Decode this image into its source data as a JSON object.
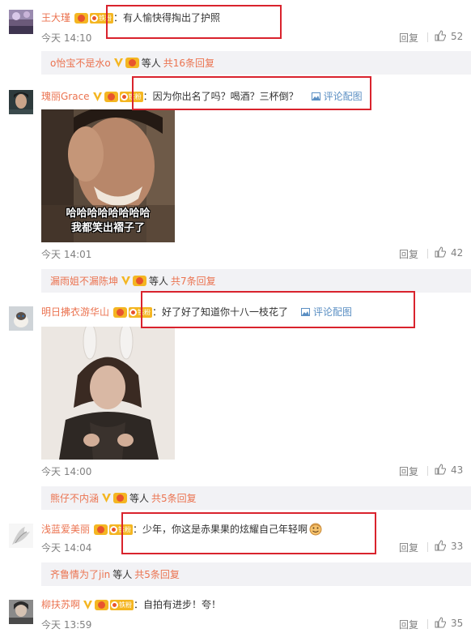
{
  "common": {
    "reply_label": "回复",
    "pic_label": "评论配图",
    "fan_badge_label": "铁粉",
    "others_label": "等人"
  },
  "comments": [
    {
      "user": "王大瑾",
      "text": "有人愉快得掏出了护照",
      "time": "今天 14:10",
      "likes": "52",
      "sub": {
        "who": "o怡宝不是水o",
        "total": "共16条回复"
      }
    },
    {
      "user": "瑰丽Grace",
      "text": "因为你出名了吗？喝酒？三杯倒？",
      "has_pic": true,
      "image_caption_line1": "哈哈哈哈哈哈哈哈",
      "image_caption_line2": "我都笑出褶子了",
      "time": "今天 14:01",
      "likes": "42",
      "sub": {
        "who": "漏雨姐不漏陈坤",
        "total": "共7条回复"
      }
    },
    {
      "user": "明日拂衣游华山",
      "text": "好了好了知道你十八一枝花了",
      "has_pic": true,
      "time": "今天 14:00",
      "likes": "43",
      "sub": {
        "who": "熊仔不内涵",
        "total": "共5条回复"
      }
    },
    {
      "user": "浅蓝爱美丽",
      "text": "少年，你这是赤果果的炫耀自己年轻啊",
      "time": "今天 14:04",
      "likes": "33",
      "sub": {
        "who": "齐鲁情为了jin",
        "total": "共5条回复"
      }
    },
    {
      "user": "柳扶苏啊",
      "text": "自拍有进步！夸！",
      "time": "今天 13:59",
      "likes": "35"
    }
  ],
  "colors": {
    "username": "#eb7350",
    "link": "#5b8fc3",
    "highlight_box": "#d9232d",
    "sub_bar_bg": "#f2f2f5",
    "meta_text": "#808080"
  }
}
